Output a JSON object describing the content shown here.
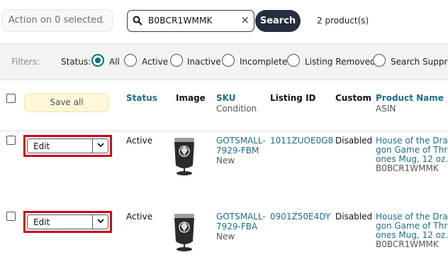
{
  "toolbar": {
    "action_label": "Action on 0 selected",
    "search_value": "B0BCR1WMMK",
    "search_label": "Search",
    "count_label": "2 product(s)"
  },
  "filters": {
    "label": "Filters:",
    "status_label": "Status:",
    "options": [
      {
        "label": "All",
        "selected": true
      },
      {
        "label": "Active",
        "selected": false
      },
      {
        "label": "Inactive",
        "selected": false
      },
      {
        "label": "Incomplete",
        "selected": false
      },
      {
        "label": "Listing Removed",
        "selected": false
      },
      {
        "label": "Search Suppre",
        "selected": false
      }
    ]
  },
  "table": {
    "save_all": "Save all",
    "headers": {
      "status": "Status",
      "image": "Image",
      "sku": "SKU",
      "condition": "Condition",
      "listing_id": "Listing ID",
      "custom": "Custom",
      "product_name": "Product Name",
      "asin": "ASIN"
    },
    "rows": [
      {
        "action": "Edit",
        "status": "Active",
        "sku_line1": "GOTSMALL-",
        "sku_line2": "7929-FBM",
        "condition": "New",
        "listing_id": "1011ZUOE0G8",
        "custom": "Disabled",
        "name_line1": "House of the Dra",
        "name_line2": "gon Game of Thr",
        "name_line3": "ones Mug, 12 oz.",
        "asin": "B0BCR1WMMK"
      },
      {
        "action": "Edit",
        "status": "Active",
        "sku_line1": "GOTSMALL-",
        "sku_line2": "7929-FBA",
        "condition": "New",
        "listing_id": "0901Z50E4DY",
        "custom": "Disabled",
        "name_line1": "House of the Dra",
        "name_line2": "gon Game of Thr",
        "name_line3": "ones Mug, 12 oz.",
        "asin": "B0BCR1WMMK"
      }
    ]
  },
  "colors": {
    "accent": "#007185",
    "link": "#1a6e86",
    "highlight": "#d0021b",
    "search_button": "#232f3e"
  }
}
